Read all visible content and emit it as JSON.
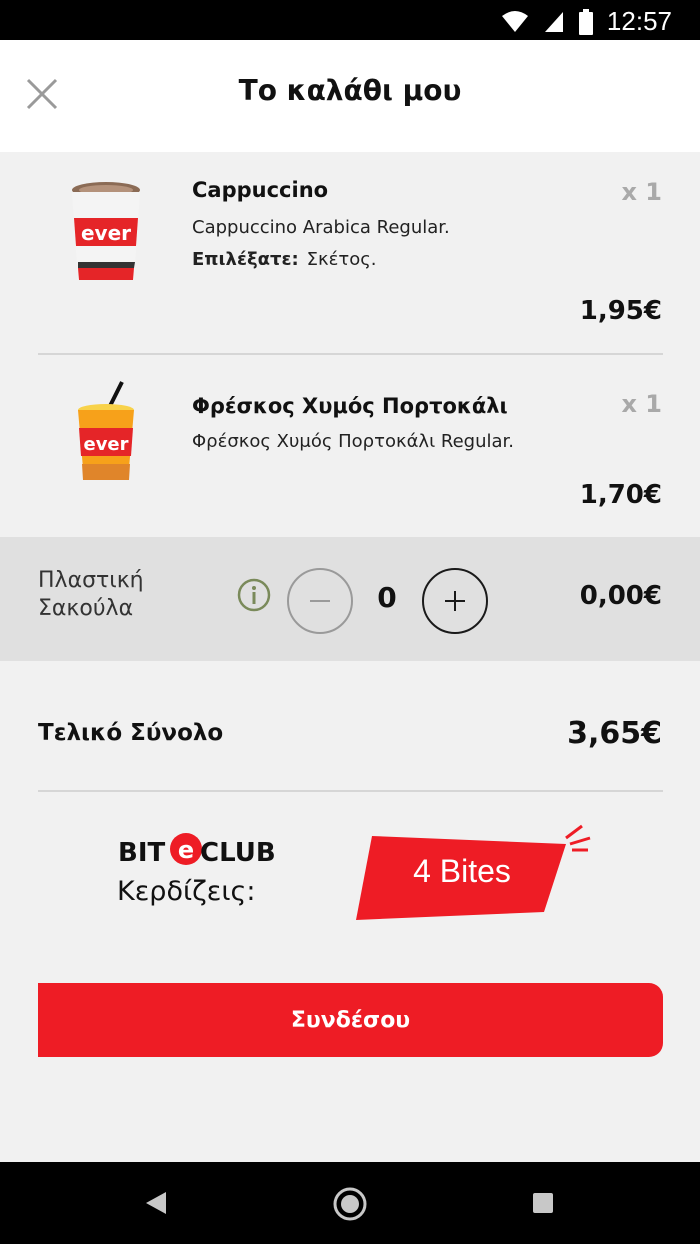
{
  "status_bar": {
    "time": "12:57",
    "icons": [
      "wifi-icon",
      "cellular-signal-icon",
      "battery-icon"
    ]
  },
  "header": {
    "title": "Το καλάθι μου",
    "close_icon": "close-icon"
  },
  "cart": {
    "items": [
      {
        "name": "Cappuccino",
        "description": "Cappuccino Arabica Regular.",
        "choice_label": "Επιλέξατε:",
        "choice_value": "Σκέτος.",
        "quantity": "x 1",
        "price": "1,95€",
        "thumbnail": "coffee-cup-image"
      },
      {
        "name": "Φρέσκος Χυμός Πορτοκάλι",
        "description": "Φρέσκος Χυμός Πορτοκάλι Regular.",
        "quantity": "x 1",
        "price": "1,70€",
        "thumbnail": "orange-juice-cup-image"
      }
    ]
  },
  "plastic_bag": {
    "label_line1": "Πλαστική",
    "label_line2": "Σακούλα",
    "count": "0",
    "price": "0,00€",
    "info_icon": "info-icon",
    "minus_icon": "minus-icon",
    "plus_icon": "plus-icon"
  },
  "total": {
    "label": "Τελικό Σύνολο",
    "value": "3,65€"
  },
  "biteclub": {
    "logo_text": "BITECLUB",
    "earn_label": "Κερδίζεις:",
    "bites": "4 Bites"
  },
  "login_button": "Συνδέσου",
  "navigation": {
    "icons": [
      "back-icon",
      "home-icon",
      "recents-icon"
    ]
  },
  "colors": {
    "brand_red": "#ee1c25",
    "background": "#f1f1f1",
    "bag_row": "#e0e0e0",
    "info_green": "#7a8a5a"
  }
}
